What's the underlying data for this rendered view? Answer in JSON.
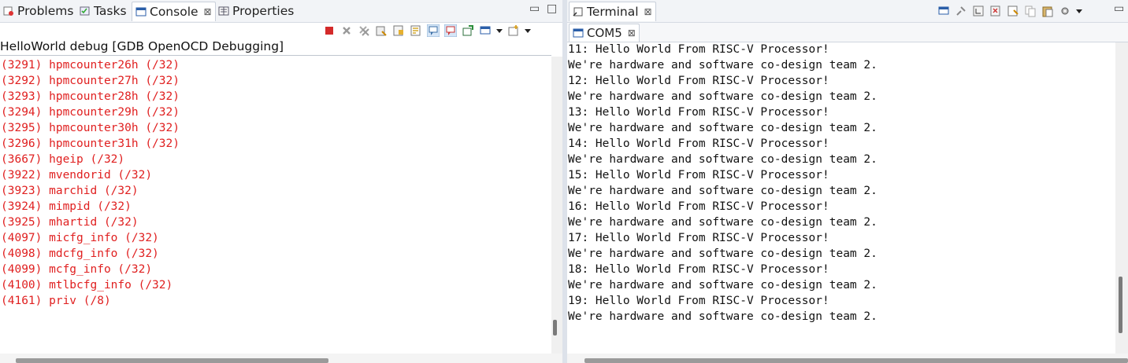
{
  "left": {
    "tabs": [
      {
        "label": "Problems",
        "icon": "problems-icon"
      },
      {
        "label": "Tasks",
        "icon": "tasks-icon"
      },
      {
        "label": "Console",
        "icon": "console-icon",
        "active": true
      },
      {
        "label": "Properties",
        "icon": "properties-icon"
      }
    ],
    "console_title": "HelloWorld debug [GDB OpenOCD Debugging]",
    "lines": [
      "(3291) hpmcounter26h (/32)",
      "(3292) hpmcounter27h (/32)",
      "(3293) hpmcounter28h (/32)",
      "(3294) hpmcounter29h (/32)",
      "(3295) hpmcounter30h (/32)",
      "(3296) hpmcounter31h (/32)",
      "(3667) hgeip (/32)",
      "(3922) mvendorid (/32)",
      "(3923) marchid (/32)",
      "(3924) mimpid (/32)",
      "(3925) mhartid (/32)",
      "(4097) micfg_info (/32)",
      "(4098) mdcfg_info (/32)",
      "(4099) mcfg_info (/32)",
      "(4100) mtlbcfg_info (/32)",
      "(4161) priv (/8)"
    ],
    "error_color": "#e02020"
  },
  "right": {
    "tab": {
      "label": "Terminal",
      "icon": "terminal-icon"
    },
    "subtab": {
      "label": "COM5",
      "icon": "serial-port-icon"
    },
    "lines": [
      "11: Hello World From RISC-V Processor!",
      "We're hardware and software co-design team 2.",
      "12: Hello World From RISC-V Processor!",
      "We're hardware and software co-design team 2.",
      "13: Hello World From RISC-V Processor!",
      "We're hardware and software co-design team 2.",
      "14: Hello World From RISC-V Processor!",
      "We're hardware and software co-design team 2.",
      "15: Hello World From RISC-V Processor!",
      "We're hardware and software co-design team 2.",
      "16: Hello World From RISC-V Processor!",
      "We're hardware and software co-design team 2.",
      "17: Hello World From RISC-V Processor!",
      "We're hardware and software co-design team 2.",
      "18: Hello World From RISC-V Processor!",
      "We're hardware and software co-design team 2.",
      "19: Hello World From RISC-V Processor!",
      "We're hardware and software co-design team 2."
    ]
  },
  "close_glyph": "⊠",
  "minimize_glyph": "▭",
  "maximize_glyph": "□"
}
